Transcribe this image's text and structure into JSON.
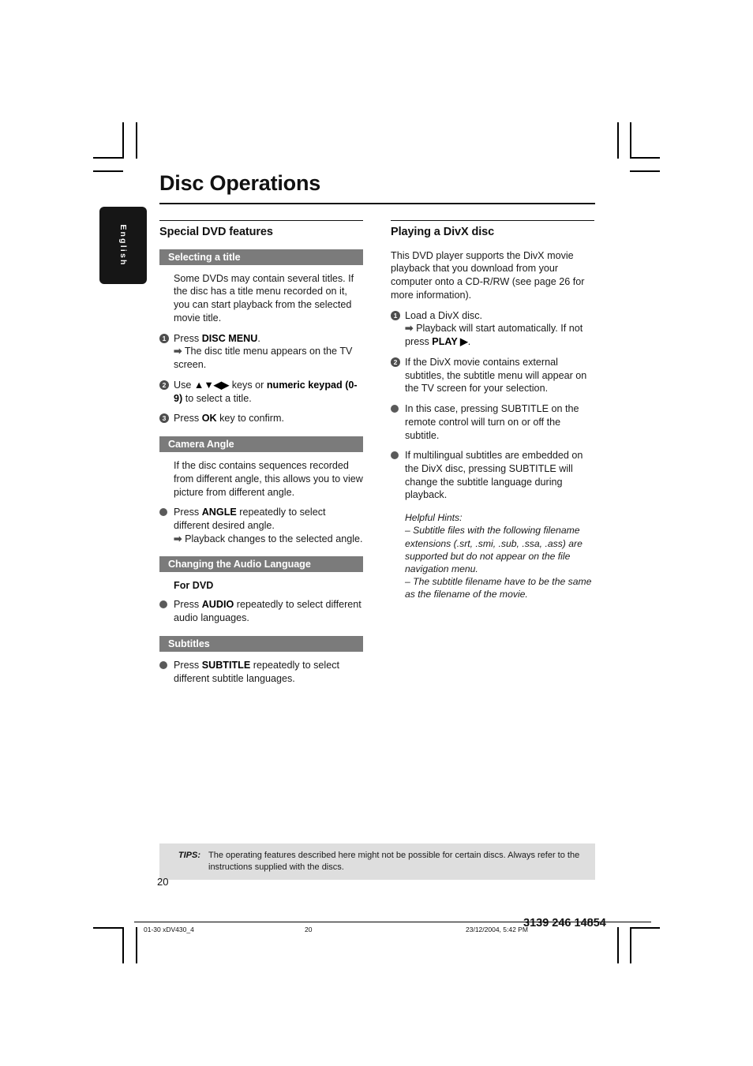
{
  "language_tab": "English",
  "header": {
    "title": "Disc Operations"
  },
  "left_column": {
    "heading": "Special DVD features",
    "sections": [
      {
        "bar": "Selecting a title",
        "intro": "Some DVDs may contain several titles. If the disc has a title menu recorded on it, you can start playback from the selected movie title.",
        "steps": [
          {
            "num": "1",
            "text": "Press DISC MENU.",
            "bold": "DISC MENU",
            "arrow": "The disc title menu appears on the TV screen."
          },
          {
            "num": "2",
            "text": "Use ▲▼◀ ▶ keys or numeric keypad (0-9) to select a title."
          },
          {
            "num": "3",
            "text": "Press OK key to confirm."
          }
        ]
      },
      {
        "bar": "Camera Angle",
        "intro": "If the disc contains sequences recorded from different angle, this allows you to view picture from different angle.",
        "bullets": [
          {
            "text": "Press ANGLE repeatedly to select different desired angle.",
            "arrow": "Playback changes to the selected angle."
          }
        ]
      },
      {
        "bar": "Changing the Audio Language",
        "sub_head": "For DVD",
        "bullets": [
          {
            "text": "Press AUDIO repeatedly to select different audio languages."
          }
        ]
      },
      {
        "bar": "Subtitles",
        "bullets": [
          {
            "text": "Press SUBTITLE repeatedly to select different subtitle languages."
          }
        ]
      }
    ]
  },
  "right_column": {
    "heading": "Playing a DivX disc",
    "intro": "This DVD player supports the DivX movie playback that you download from your computer onto a CD-R/RW (see page 26 for more information).",
    "steps": [
      {
        "num": "1",
        "text": "Load a DivX disc.",
        "arrow": "Playback will start automatically. If not press PLAY ▶."
      },
      {
        "num": "2",
        "text": "If the DivX movie contains external subtitles, the subtitle menu will appear on the TV screen for your selection."
      }
    ],
    "bullets": [
      {
        "text": "In this case, pressing SUBTITLE on the remote control will turn on or off the subtitle."
      },
      {
        "text": "If multilingual subtitles are embedded on the DivX disc, pressing SUBTITLE will change the subtitle language during playback."
      }
    ],
    "hints_title": "Helpful Hints:",
    "hints": [
      "–    Subtitle files with the following filename extensions (.srt, .smi, .sub, .ssa, .ass) are supported but do not appear on the file navigation menu.",
      "–    The subtitle filename have to be the same as the filename of the movie."
    ]
  },
  "tips": {
    "label": "TIPS:",
    "text": "The operating features described here might not be possible for certain discs.  Always refer to the instructions supplied with the discs."
  },
  "page_number": "20",
  "print_footer": {
    "file": "01-30 xDV430_4",
    "page": "20",
    "date": "23/12/2004, 5:42 PM",
    "code": "3139 246 14854"
  }
}
